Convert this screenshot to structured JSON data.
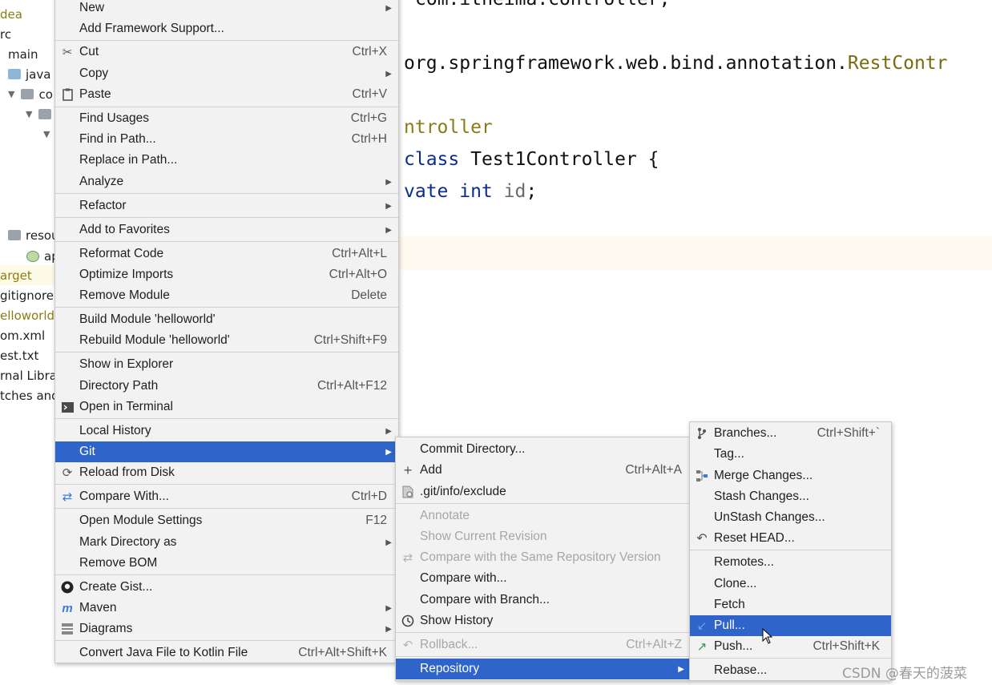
{
  "project_tree": {
    "items": [
      {
        "label": "dea"
      },
      {
        "label": "rc"
      },
      {
        "label": "main"
      },
      {
        "label": "java"
      },
      {
        "label": "co"
      },
      {
        "label": "resou"
      },
      {
        "label": "ap"
      },
      {
        "label": "arget"
      },
      {
        "label": "gitignore"
      },
      {
        "label": "elloworld."
      },
      {
        "label": "om.xml"
      },
      {
        "label": "est.txt"
      },
      {
        "label": "rnal Librar"
      },
      {
        "label": "tches and"
      }
    ]
  },
  "editor": {
    "lines": [
      {
        "pre": "",
        "a": "com.itheima.controller;"
      },
      {
        "pre": "org.springframework.web.bind.annotation.",
        "a": "RestContr"
      },
      {
        "pre": "",
        "a": "ntroller"
      },
      {
        "kw": "class",
        "a": " Test1Controller {"
      },
      {
        "kw": "vate int",
        "a": " ",
        "fld": "id",
        "b": ";"
      }
    ]
  },
  "context_menu": {
    "items": [
      {
        "label": "New",
        "shortcut": "",
        "submenu": true
      },
      {
        "label": "Add Framework Support...",
        "shortcut": ""
      },
      {
        "label": "Cut",
        "shortcut": "Ctrl+X",
        "icon": "scissors-icon"
      },
      {
        "label": "Copy",
        "shortcut": "",
        "submenu": true
      },
      {
        "label": "Paste",
        "shortcut": "Ctrl+V",
        "icon": "clipboard-icon"
      },
      {
        "label": "Find Usages",
        "shortcut": "Ctrl+G"
      },
      {
        "label": "Find in Path...",
        "shortcut": "Ctrl+H"
      },
      {
        "label": "Replace in Path...",
        "shortcut": ""
      },
      {
        "label": "Analyze",
        "shortcut": "",
        "submenu": true
      },
      {
        "label": "Refactor",
        "shortcut": "",
        "submenu": true
      },
      {
        "label": "Add to Favorites",
        "shortcut": "",
        "submenu": true
      },
      {
        "label": "Reformat Code",
        "shortcut": "Ctrl+Alt+L"
      },
      {
        "label": "Optimize Imports",
        "shortcut": "Ctrl+Alt+O"
      },
      {
        "label": "Remove Module",
        "shortcut": "Delete"
      },
      {
        "label": "Build Module 'helloworld'",
        "shortcut": ""
      },
      {
        "label": "Rebuild Module 'helloworld'",
        "shortcut": "Ctrl+Shift+F9"
      },
      {
        "label": "Show in Explorer",
        "shortcut": ""
      },
      {
        "label": "Directory Path",
        "shortcut": "Ctrl+Alt+F12"
      },
      {
        "label": "Open in Terminal",
        "shortcut": "",
        "icon": "terminal-icon"
      },
      {
        "label": "Local History",
        "shortcut": "",
        "submenu": true
      },
      {
        "label": "Git",
        "shortcut": "",
        "submenu": true,
        "selected": true
      },
      {
        "label": "Reload from Disk",
        "shortcut": "",
        "icon": "reload-icon"
      },
      {
        "label": "Compare With...",
        "shortcut": "Ctrl+D",
        "icon": "compare-icon"
      },
      {
        "label": "Open Module Settings",
        "shortcut": "F12"
      },
      {
        "label": "Mark Directory as",
        "shortcut": "",
        "submenu": true
      },
      {
        "label": "Remove BOM",
        "shortcut": ""
      },
      {
        "label": "Create Gist...",
        "shortcut": "",
        "icon": "github-icon"
      },
      {
        "label": "Maven",
        "shortcut": "",
        "submenu": true,
        "icon": "maven-icon"
      },
      {
        "label": "Diagrams",
        "shortcut": "",
        "submenu": true,
        "icon": "diagram-icon"
      },
      {
        "label": "Convert Java File to Kotlin File",
        "shortcut": "Ctrl+Alt+Shift+K"
      }
    ]
  },
  "git_menu": {
    "items": [
      {
        "label": "Commit Directory...",
        "shortcut": ""
      },
      {
        "label": "Add",
        "shortcut": "Ctrl+Alt+A",
        "icon": "plus-icon"
      },
      {
        "label": ".git/info/exclude",
        "shortcut": "",
        "icon": "file-ignore-icon"
      },
      {
        "label": "Annotate",
        "shortcut": "",
        "disabled": true
      },
      {
        "label": "Show Current Revision",
        "shortcut": "",
        "disabled": true
      },
      {
        "label": "Compare with the Same Repository Version",
        "shortcut": "",
        "disabled": true,
        "icon": "compare-icon"
      },
      {
        "label": "Compare with...",
        "shortcut": ""
      },
      {
        "label": "Compare with Branch...",
        "shortcut": ""
      },
      {
        "label": "Show History",
        "shortcut": "",
        "icon": "clock-icon"
      },
      {
        "label": "Rollback...",
        "shortcut": "Ctrl+Alt+Z",
        "disabled": true,
        "icon": "undo-icon"
      },
      {
        "label": "Repository",
        "shortcut": "",
        "submenu": true,
        "selected": true
      }
    ]
  },
  "repository_menu": {
    "items": [
      {
        "label": "Branches...",
        "shortcut": "Ctrl+Shift+`",
        "icon": "branch-icon"
      },
      {
        "label": "Tag...",
        "shortcut": ""
      },
      {
        "label": "Merge Changes...",
        "shortcut": "",
        "icon": "merge-icon"
      },
      {
        "label": "Stash Changes...",
        "shortcut": ""
      },
      {
        "label": "UnStash Changes...",
        "shortcut": ""
      },
      {
        "label": "Reset HEAD...",
        "shortcut": "",
        "icon": "reset-icon"
      },
      {
        "label": "Remotes...",
        "shortcut": ""
      },
      {
        "label": "Clone...",
        "shortcut": ""
      },
      {
        "label": "Fetch",
        "shortcut": ""
      },
      {
        "label": "Pull...",
        "shortcut": "",
        "selected": true,
        "icon": "pull-arrow-icon"
      },
      {
        "label": "Push...",
        "shortcut": "Ctrl+Shift+K",
        "icon": "push-arrow-icon"
      },
      {
        "label": "Rebase...",
        "shortcut": ""
      }
    ]
  },
  "watermark": "CSDN @春天的菠菜",
  "colors": {
    "selection": "#2f65ca",
    "menu_bg": "#f2f2f2",
    "annotation": "#8a7b14",
    "keyword": "#0b2c8f"
  }
}
